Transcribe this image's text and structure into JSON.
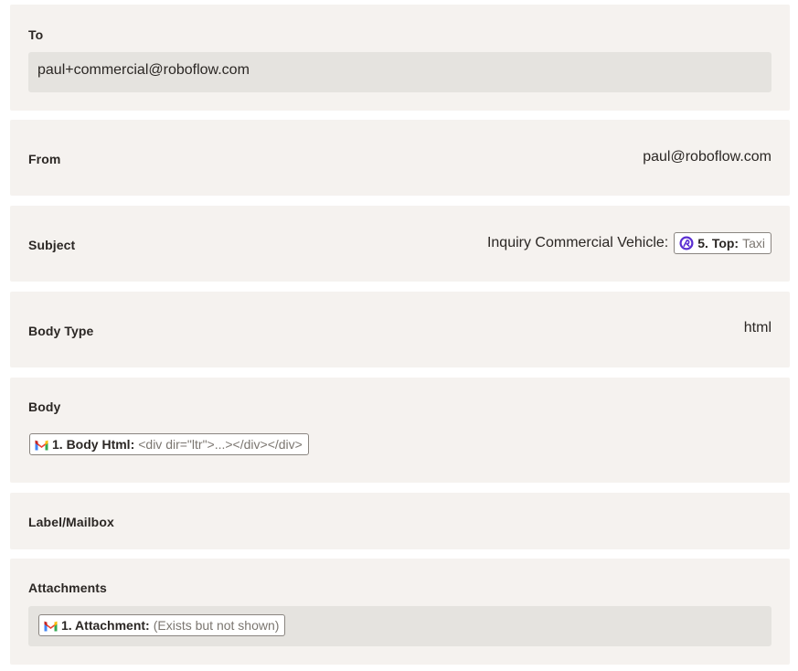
{
  "colors": {
    "card_bg": "#f5f2ef",
    "field_bg": "#e5e3df",
    "text": "#2b2724",
    "muted_text": "#7b7670",
    "pill_border": "#8a8580",
    "app_purple": "#5b2fd1"
  },
  "fields": {
    "to": {
      "label": "To",
      "value": "paul+commercial@roboflow.com"
    },
    "from": {
      "label": "From",
      "value": "paul@roboflow.com"
    },
    "subject": {
      "label": "Subject",
      "prefix": "Inquiry Commercial Vehicle:",
      "token": {
        "icon": "roboflow-app-icon",
        "step": "5. Top:",
        "value": "Taxi"
      }
    },
    "body_type": {
      "label": "Body Type",
      "value": "html"
    },
    "body": {
      "label": "Body",
      "token": {
        "icon": "gmail-icon",
        "step": "1. Body Html:",
        "value": "<div dir=\"ltr\">...></div></div>"
      }
    },
    "label_mailbox": {
      "label": "Label/Mailbox"
    },
    "attachments": {
      "label": "Attachments",
      "token": {
        "icon": "gmail-icon",
        "step": "1. Attachment:",
        "value": "(Exists but not shown)"
      }
    }
  }
}
